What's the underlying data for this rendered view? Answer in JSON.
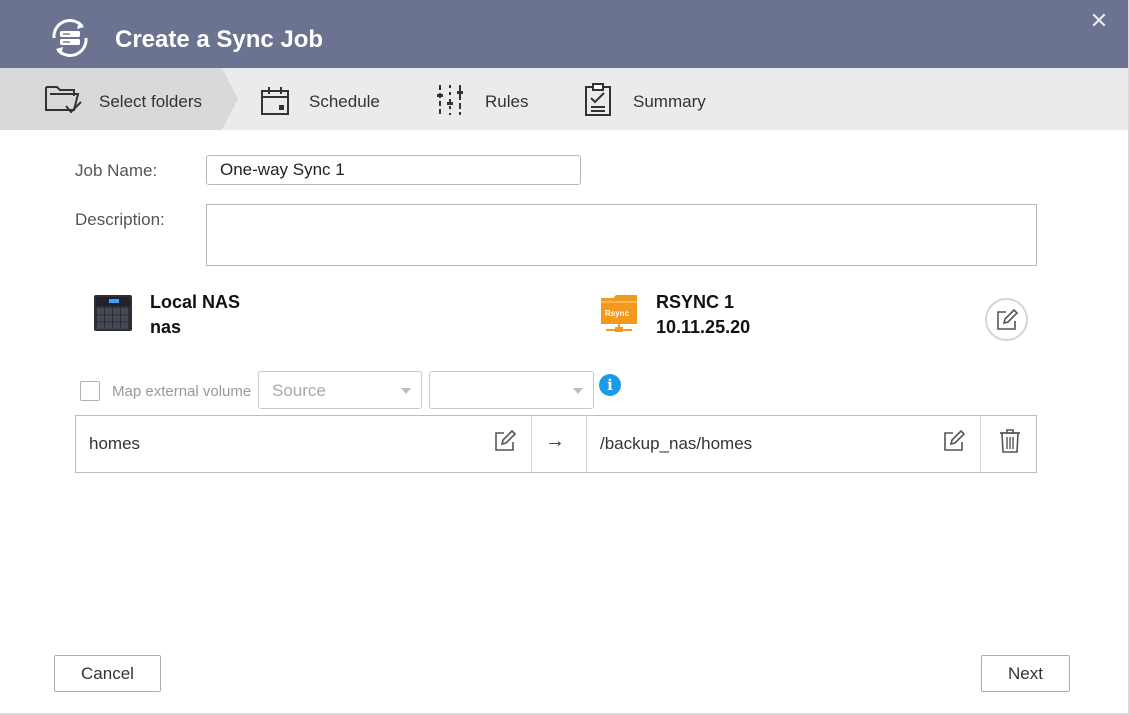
{
  "window": {
    "title": "Create a Sync Job",
    "close_glyph": "✕",
    "app_icon": "sync-job-icon"
  },
  "steps": [
    {
      "label": "Select folders",
      "icon": "folder-check-icon",
      "active": true
    },
    {
      "label": "Schedule",
      "icon": "calendar-icon",
      "active": false
    },
    {
      "label": "Rules",
      "icon": "sliders-icon",
      "active": false
    },
    {
      "label": "Summary",
      "icon": "clipboard-check-icon",
      "active": false
    }
  ],
  "form": {
    "job_name_label": "Job Name:",
    "job_name_value": "One-way Sync 1",
    "description_label": "Description:",
    "description_value": ""
  },
  "source": {
    "icon": "nas-device-icon",
    "line1": "Local NAS",
    "line2": "nas"
  },
  "destination": {
    "icon": "rsync-server-icon",
    "icon_text": "Rsync",
    "line1": "RSYNC 1",
    "line2": "10.11.25.20"
  },
  "map_external": {
    "label": "Map external volume",
    "checked": false,
    "source_select": "Source",
    "second_select": ""
  },
  "info_glyph": "i",
  "mapping": {
    "source_folder": "homes",
    "arrow": "→",
    "destination_folder": "/backup_nas/homes"
  },
  "buttons": {
    "cancel": "Cancel",
    "next": "Next"
  },
  "colors": {
    "titlebar": "#6b7390",
    "stepbar": "#ebebeb",
    "active_step": "#d9d9d9",
    "rsync_orange": "#f39a1e",
    "info_blue": "#1a9be9"
  }
}
